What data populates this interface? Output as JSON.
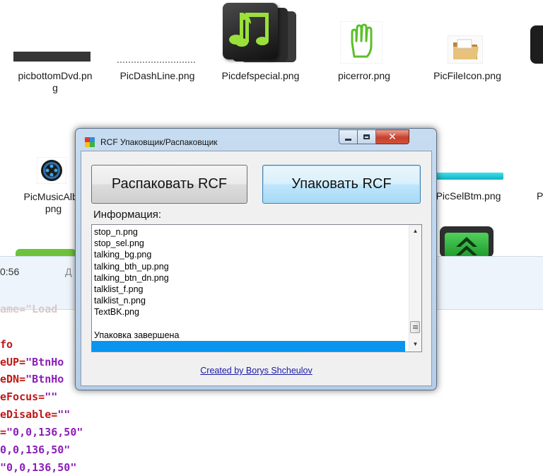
{
  "desktop": {
    "files": [
      {
        "name": "picbottomDvd.png",
        "line1": "picbottomDvd.pn",
        "line2": "g"
      },
      {
        "name": "PicDashLine.png"
      },
      {
        "name": "Picdefspecial.png"
      },
      {
        "name": "picerror.png"
      },
      {
        "name": "PicFileIcon.png"
      },
      {
        "name": "PicMusicAlbum.png",
        "line1": "PicMusicAlbu",
        "line2": "png"
      },
      {
        "name": "PicSelBtm.png"
      },
      {
        "name": "P"
      }
    ]
  },
  "background": {
    "time": "0:56",
    "letter": "Д",
    "code_lines": [
      {
        "attr": "ame=",
        "val": "\"Load"
      },
      {
        "attr": "fo",
        "val": ""
      },
      {
        "attr": "eUP=",
        "val": "\"BtnHo"
      },
      {
        "attr": "eDN=",
        "val": "\"BtnHo"
      },
      {
        "attr": "eFocus=",
        "val": "\"\""
      },
      {
        "attr": "eDisable=",
        "val": "\"\""
      },
      {
        "attr": "=",
        "val": "\"0,0,136,50\""
      },
      {
        "attr": "",
        "val": "0,0,136,50\""
      },
      {
        "attr": "",
        "val": "\"0,0,136,50\""
      }
    ]
  },
  "dialog": {
    "title": "RCF Упаковщик/Распаковщик",
    "unpack_label": "Распаковать RCF",
    "pack_label": "Упаковать RCF",
    "info_label": "Информация:",
    "list_items": [
      "stop_n.png",
      "stop_sel.png",
      "talking_bg.png",
      "talking_bth_up.png",
      "talking_btn_dn.png",
      "talklist_f.png",
      "talklist_n.png",
      "TextBK.png",
      "",
      "Упаковка завершена",
      ""
    ],
    "selected_index": 10,
    "credits": "Created by Borys Shcheulov"
  }
}
